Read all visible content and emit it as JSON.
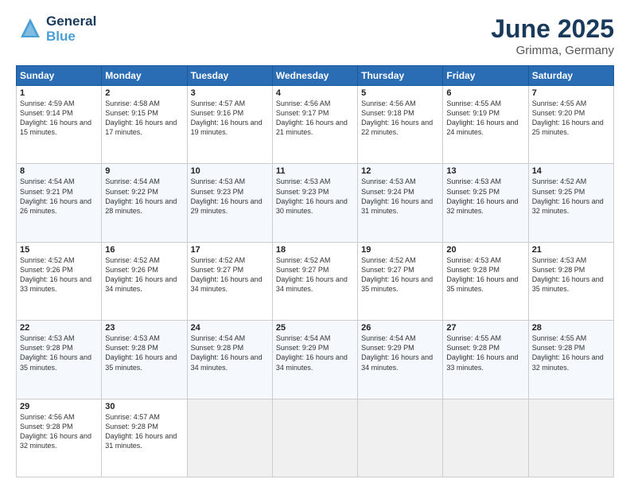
{
  "header": {
    "logo_general": "General",
    "logo_blue": "Blue",
    "title": "June 2025",
    "subtitle": "Grimma, Germany"
  },
  "days_of_week": [
    "Sunday",
    "Monday",
    "Tuesday",
    "Wednesday",
    "Thursday",
    "Friday",
    "Saturday"
  ],
  "weeks": [
    [
      {
        "day": "1",
        "info": "Sunrise: 4:59 AM\nSunset: 9:14 PM\nDaylight: 16 hours and 15 minutes."
      },
      {
        "day": "2",
        "info": "Sunrise: 4:58 AM\nSunset: 9:15 PM\nDaylight: 16 hours and 17 minutes."
      },
      {
        "day": "3",
        "info": "Sunrise: 4:57 AM\nSunset: 9:16 PM\nDaylight: 16 hours and 19 minutes."
      },
      {
        "day": "4",
        "info": "Sunrise: 4:56 AM\nSunset: 9:17 PM\nDaylight: 16 hours and 21 minutes."
      },
      {
        "day": "5",
        "info": "Sunrise: 4:56 AM\nSunset: 9:18 PM\nDaylight: 16 hours and 22 minutes."
      },
      {
        "day": "6",
        "info": "Sunrise: 4:55 AM\nSunset: 9:19 PM\nDaylight: 16 hours and 24 minutes."
      },
      {
        "day": "7",
        "info": "Sunrise: 4:55 AM\nSunset: 9:20 PM\nDaylight: 16 hours and 25 minutes."
      }
    ],
    [
      {
        "day": "8",
        "info": "Sunrise: 4:54 AM\nSunset: 9:21 PM\nDaylight: 16 hours and 26 minutes."
      },
      {
        "day": "9",
        "info": "Sunrise: 4:54 AM\nSunset: 9:22 PM\nDaylight: 16 hours and 28 minutes."
      },
      {
        "day": "10",
        "info": "Sunrise: 4:53 AM\nSunset: 9:23 PM\nDaylight: 16 hours and 29 minutes."
      },
      {
        "day": "11",
        "info": "Sunrise: 4:53 AM\nSunset: 9:23 PM\nDaylight: 16 hours and 30 minutes."
      },
      {
        "day": "12",
        "info": "Sunrise: 4:53 AM\nSunset: 9:24 PM\nDaylight: 16 hours and 31 minutes."
      },
      {
        "day": "13",
        "info": "Sunrise: 4:53 AM\nSunset: 9:25 PM\nDaylight: 16 hours and 32 minutes."
      },
      {
        "day": "14",
        "info": "Sunrise: 4:52 AM\nSunset: 9:25 PM\nDaylight: 16 hours and 32 minutes."
      }
    ],
    [
      {
        "day": "15",
        "info": "Sunrise: 4:52 AM\nSunset: 9:26 PM\nDaylight: 16 hours and 33 minutes."
      },
      {
        "day": "16",
        "info": "Sunrise: 4:52 AM\nSunset: 9:26 PM\nDaylight: 16 hours and 34 minutes."
      },
      {
        "day": "17",
        "info": "Sunrise: 4:52 AM\nSunset: 9:27 PM\nDaylight: 16 hours and 34 minutes."
      },
      {
        "day": "18",
        "info": "Sunrise: 4:52 AM\nSunset: 9:27 PM\nDaylight: 16 hours and 34 minutes."
      },
      {
        "day": "19",
        "info": "Sunrise: 4:52 AM\nSunset: 9:27 PM\nDaylight: 16 hours and 35 minutes."
      },
      {
        "day": "20",
        "info": "Sunrise: 4:53 AM\nSunset: 9:28 PM\nDaylight: 16 hours and 35 minutes."
      },
      {
        "day": "21",
        "info": "Sunrise: 4:53 AM\nSunset: 9:28 PM\nDaylight: 16 hours and 35 minutes."
      }
    ],
    [
      {
        "day": "22",
        "info": "Sunrise: 4:53 AM\nSunset: 9:28 PM\nDaylight: 16 hours and 35 minutes."
      },
      {
        "day": "23",
        "info": "Sunrise: 4:53 AM\nSunset: 9:28 PM\nDaylight: 16 hours and 35 minutes."
      },
      {
        "day": "24",
        "info": "Sunrise: 4:54 AM\nSunset: 9:28 PM\nDaylight: 16 hours and 34 minutes."
      },
      {
        "day": "25",
        "info": "Sunrise: 4:54 AM\nSunset: 9:29 PM\nDaylight: 16 hours and 34 minutes."
      },
      {
        "day": "26",
        "info": "Sunrise: 4:54 AM\nSunset: 9:29 PM\nDaylight: 16 hours and 34 minutes."
      },
      {
        "day": "27",
        "info": "Sunrise: 4:55 AM\nSunset: 9:28 PM\nDaylight: 16 hours and 33 minutes."
      },
      {
        "day": "28",
        "info": "Sunrise: 4:55 AM\nSunset: 9:28 PM\nDaylight: 16 hours and 32 minutes."
      }
    ],
    [
      {
        "day": "29",
        "info": "Sunrise: 4:56 AM\nSunset: 9:28 PM\nDaylight: 16 hours and 32 minutes."
      },
      {
        "day": "30",
        "info": "Sunrise: 4:57 AM\nSunset: 9:28 PM\nDaylight: 16 hours and 31 minutes."
      },
      {
        "day": "",
        "info": ""
      },
      {
        "day": "",
        "info": ""
      },
      {
        "day": "",
        "info": ""
      },
      {
        "day": "",
        "info": ""
      },
      {
        "day": "",
        "info": ""
      }
    ]
  ]
}
